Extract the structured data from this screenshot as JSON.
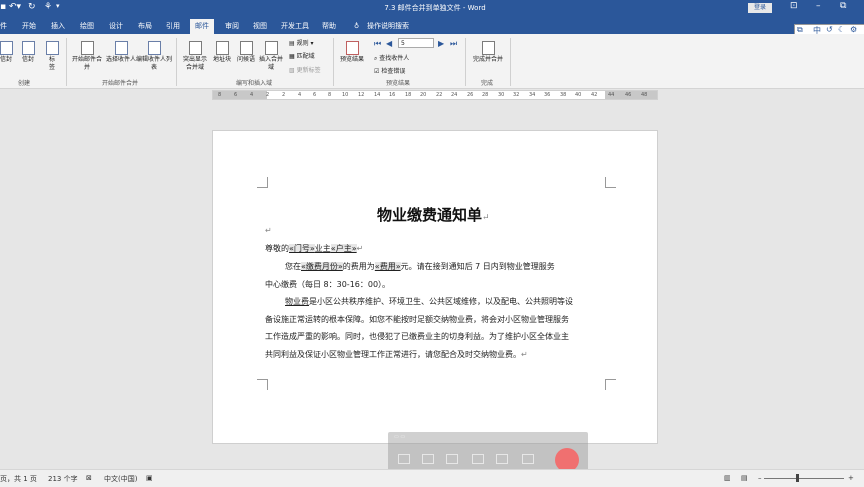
{
  "window": {
    "title": "7.3 邮件合并到单独文件 - Word",
    "login_label": "登录",
    "minimize_icon": "ribbon-display-icon",
    "restore_label": "⧉"
  },
  "tabs": [
    "件",
    "开始",
    "插入",
    "绘图",
    "设计",
    "布局",
    "引用",
    "邮件",
    "审阅",
    "视图",
    "开发工具",
    "帮助",
    "操作说明搜索"
  ],
  "active_tab": "邮件",
  "ribbon": {
    "create": {
      "group": "创建",
      "b1": "信封",
      "b2": "信封",
      "b3": "标签"
    },
    "start": {
      "group": "开始邮件合并",
      "b1": "开始邮件合并",
      "b2": "选择收件人",
      "b3": "编辑收件人列表"
    },
    "fields": {
      "group": "编写和插入域",
      "b1": "突出显示合并域",
      "b2": "地址块",
      "b3": "问候语",
      "b4": "插入合并域",
      "s1": "规则",
      "s2": "匹配域",
      "s3": "更新标签"
    },
    "preview": {
      "group": "预览结果",
      "b1": "预览结果",
      "record": "5",
      "s1": "查找收件人",
      "s2": "检查错误"
    },
    "finish": {
      "group": "完成",
      "b1": "完成并合并"
    }
  },
  "ruler_ticks": [
    "8",
    "6",
    "4",
    "2",
    "2",
    "4",
    "6",
    "8",
    "10",
    "12",
    "14",
    "16",
    "18",
    "20",
    "22",
    "24",
    "26",
    "28",
    "30",
    "32",
    "34",
    "36",
    "38",
    "40",
    "42",
    "44",
    "46",
    "48"
  ],
  "document": {
    "title": "物业缴费通知单",
    "l1a": "尊敬的",
    "l1b": "«门号»",
    "l1c": "业主",
    "l1d": "«户主»",
    "l2a": "您在",
    "l2b": "«缴费月份»",
    "l2c": "的费用为",
    "l2d": "«费用»",
    "l2e": "元。请在接到通知后 7 日内到物业管理服务",
    "l3": "中心缴费（每日 8：30-16：00）。",
    "l4a": "物业费",
    "l4b": "是小区公共秩序维护、环境卫生、公共区域维修，以及配电、公共照明等设",
    "l5": "备设施正常运转的根本保障。如您不能按时足额交纳物业费，将会对小区物业管理服务",
    "l6": "工作造成严重的影响。同时，也侵犯了已缴费业主的切身利益。为了维护小区全体业主",
    "l7": "共同利益及保证小区物业管理工作正常进行，请您配合及时交纳物业费。",
    "mark": "↵"
  },
  "status": {
    "page": "页，共 1 页",
    "words": "213 个字",
    "lang": "中文(中国)"
  }
}
